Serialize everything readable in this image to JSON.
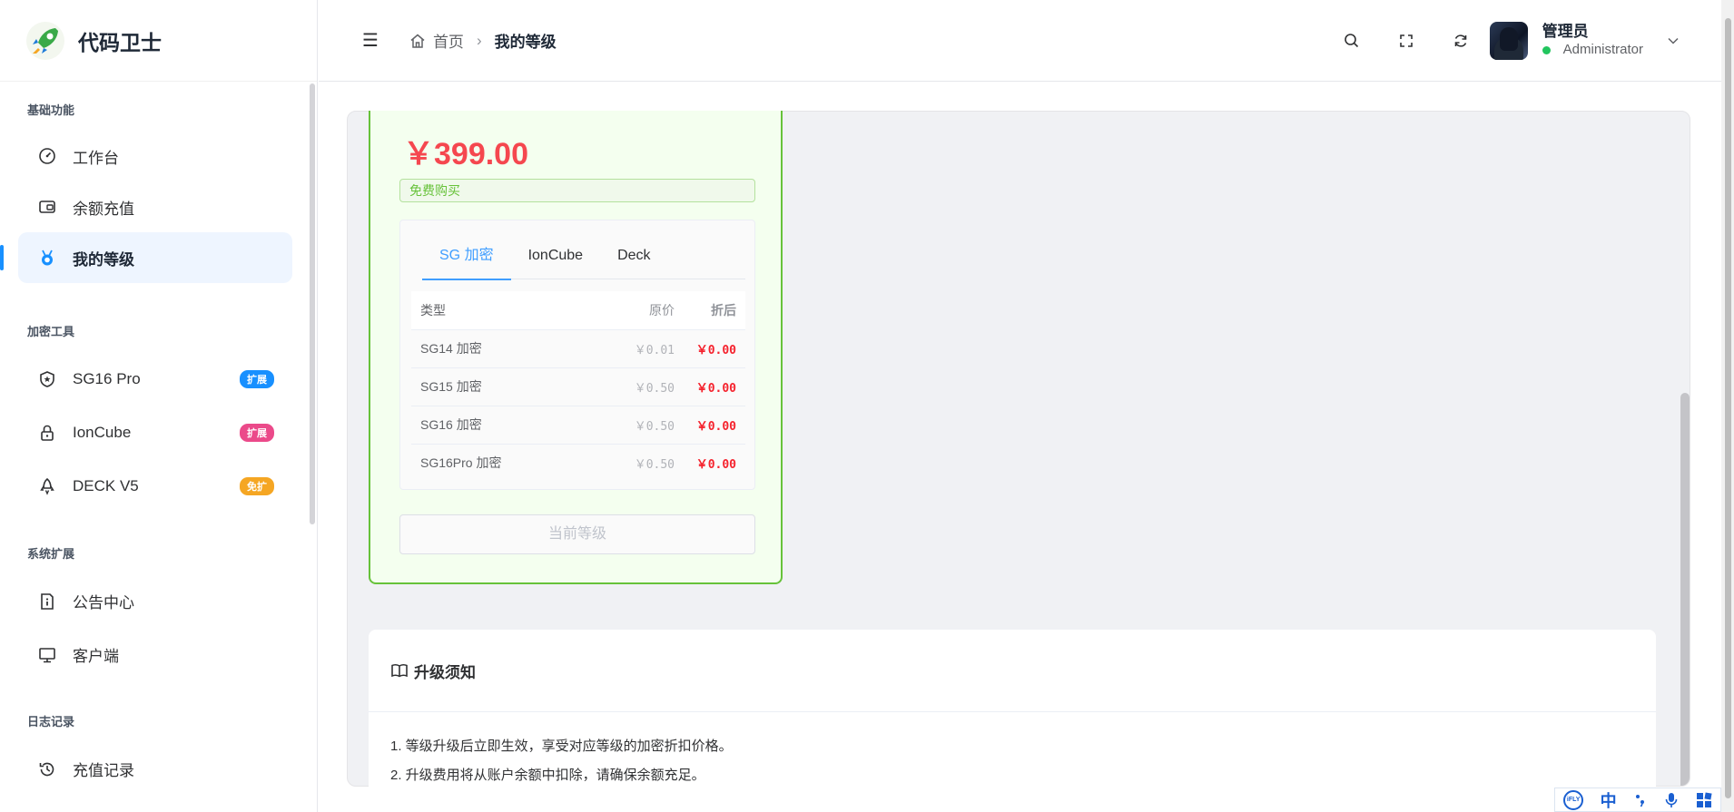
{
  "app": {
    "name": "代码卫士"
  },
  "sidebar": {
    "groups": [
      {
        "title": "基础功能",
        "items": [
          {
            "label": "工作台",
            "icon": "dashboard-icon"
          },
          {
            "label": "余额充值",
            "icon": "wallet-icon"
          },
          {
            "label": "我的等级",
            "icon": "medal-icon",
            "active": true
          }
        ]
      },
      {
        "title": "加密工具",
        "items": [
          {
            "label": "SG16 Pro",
            "icon": "shield-icon",
            "badge": "扩展",
            "badge_color": "#1890ff"
          },
          {
            "label": "IonCube",
            "icon": "lock-icon",
            "badge": "扩展",
            "badge_color": "#eb4a8a"
          },
          {
            "label": "DECK V5",
            "icon": "rocket-icon",
            "badge": "免扩",
            "badge_color": "#f5a623"
          }
        ]
      },
      {
        "title": "系统扩展",
        "items": [
          {
            "label": "公告中心",
            "icon": "notice-icon"
          },
          {
            "label": "客户端",
            "icon": "monitor-icon"
          }
        ]
      },
      {
        "title": "日志记录",
        "items": [
          {
            "label": "充值记录",
            "icon": "history-icon"
          }
        ]
      }
    ]
  },
  "header": {
    "breadcrumb_home": "首页",
    "breadcrumb_sep": "›",
    "breadcrumb_current": "我的等级",
    "user_name": "管理员",
    "user_role": "Administrator"
  },
  "level_card": {
    "price": "￥399.00",
    "tag": "免费购买",
    "tabs": [
      "SG 加密",
      "IonCube",
      "Deck"
    ],
    "active_tab": 0,
    "table_headers": [
      "类型",
      "原价",
      "折后"
    ],
    "rows": [
      {
        "type": "SG14 加密",
        "original": "￥0.01",
        "discounted": "￥0.00"
      },
      {
        "type": "SG15 加密",
        "original": "￥0.50",
        "discounted": "￥0.00"
      },
      {
        "type": "SG16 加密",
        "original": "￥0.50",
        "discounted": "￥0.00"
      },
      {
        "type": "SG16Pro 加密",
        "original": "￥0.50",
        "discounted": "￥0.00"
      }
    ],
    "button": "当前等级"
  },
  "notice": {
    "title": "升级须知",
    "lines": [
      "1. 等级升级后立即生效，享受对应等级的加密折扣价格。",
      "2. 升级费用将从账户余额中扣除，请确保余额充足。"
    ]
  },
  "ime": {
    "logo": "iFLY",
    "mode": "中"
  },
  "colors": {
    "accent": "#1890ff",
    "price_red": "#f5474f",
    "card_green": "#67c23a"
  }
}
